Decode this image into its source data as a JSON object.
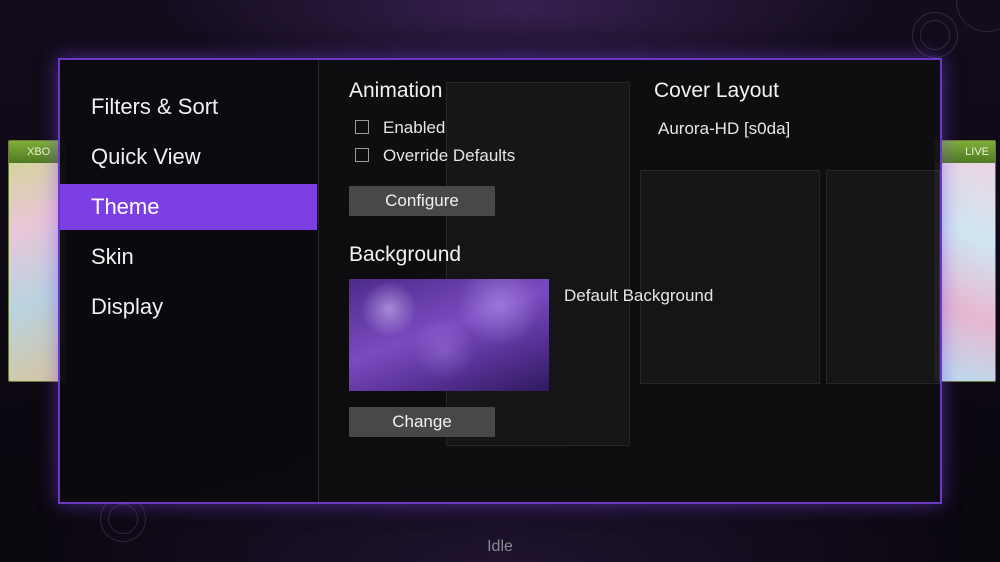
{
  "sidebar": {
    "items": [
      {
        "label": "Filters & Sort",
        "active": false
      },
      {
        "label": "Quick View",
        "active": false
      },
      {
        "label": "Theme",
        "active": true
      },
      {
        "label": "Skin",
        "active": false
      },
      {
        "label": "Display",
        "active": false
      }
    ]
  },
  "animation": {
    "heading": "Animation",
    "enabled_label": "Enabled",
    "enabled_checked": false,
    "override_label": "Override Defaults",
    "override_checked": false,
    "configure_label": "Configure"
  },
  "cover_layout": {
    "heading": "Cover Layout",
    "value": "Aurora-HD [s0da]"
  },
  "background": {
    "heading": "Background",
    "value": "Default Background",
    "change_label": "Change"
  },
  "background_covers": {
    "left_badge": "XBO",
    "right_badge": "LIVE"
  },
  "status": {
    "text": "Idle"
  },
  "colors": {
    "accent": "#7b3fe4",
    "panel_border": "#6b38c4",
    "button": "#48484a"
  }
}
